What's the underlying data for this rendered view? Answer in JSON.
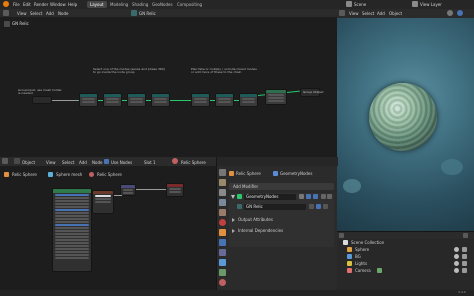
{
  "menubar": {
    "items": [
      "File",
      "Edit",
      "Render",
      "Window",
      "Help"
    ],
    "workspace_tabs": [
      "Layout",
      "Modeling",
      "Shading",
      "GeoNodes",
      "Compositing"
    ],
    "active_tab": "Layout",
    "scene_label": "Scene",
    "view_layer_label": "View Layer"
  },
  "node_editor_top": {
    "header_items": [
      "View",
      "Select",
      "Add",
      "Node"
    ],
    "breadcrumb": "GN Relic",
    "path_label": "GN Relic",
    "note_left": "Groupinput, use mesh holder\nis needed",
    "note_mid": "Select one of the modes (sense and phase 360)\nto go inside the node group",
    "note_right": "Plan fake or mutiply / unmute mixed modes\nor add more of these to the chain",
    "output_label": "Group Output"
  },
  "viewport": {
    "header_items": [
      "View",
      "Select",
      "Add",
      "Object"
    ]
  },
  "node_editor_bottom": {
    "header_items": [
      "Object",
      "View",
      "Select",
      "Add",
      "Node"
    ],
    "use_nodes_label": "Use Nodes",
    "slot_label": "Slot 1",
    "material_label": "Relic Sphere",
    "breadcrumb": [
      "Relic Sphere",
      "Sphere mesh",
      "Relic Sphere"
    ]
  },
  "properties": {
    "breadcrumb": [
      "Relic Sphere",
      "GeometryNodes"
    ],
    "add_modifier_label": "Add Modifier",
    "modifier_name": "GeometryNodes",
    "node_group": "GN Relic",
    "sections": [
      "Output Attributes",
      "Internal Dependencies"
    ]
  },
  "outliner": {
    "title": "Scene Collection",
    "items": [
      {
        "name": "Sphere",
        "color": "#e0a040"
      },
      {
        "name": "BG",
        "color": "#5a9ad8"
      },
      {
        "name": "Lights",
        "color": "#d8c040"
      },
      {
        "name": "Camera",
        "color": "#e07070"
      }
    ]
  },
  "status_bar": {
    "version": "3.4.0"
  },
  "colors": {
    "accent_green": "#27c96b",
    "accent_blue": "#4772b3",
    "panel_bg": "#2b2b2b",
    "editor_bg": "#1d1d1d"
  }
}
